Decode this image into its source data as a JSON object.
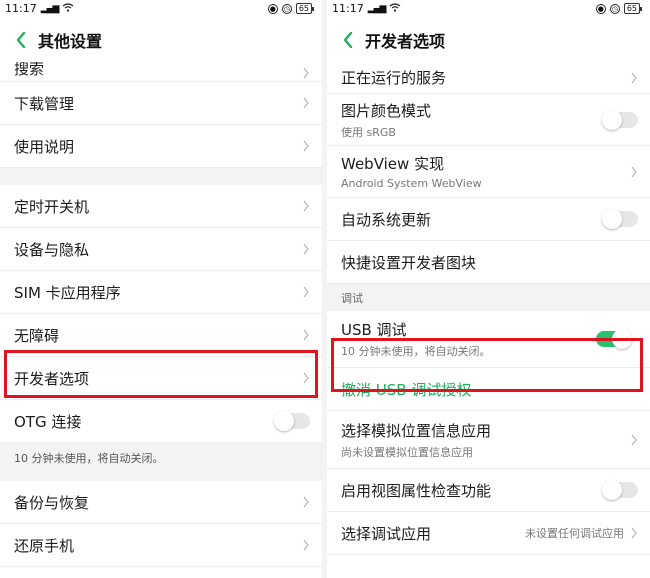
{
  "statusbar": {
    "time": "11:17",
    "signal": "4G",
    "battery": "65"
  },
  "left": {
    "title": "其他设置",
    "top_partial": "搜索",
    "group1": [
      {
        "label": "下载管理"
      },
      {
        "label": "使用说明"
      }
    ],
    "group2": [
      {
        "label": "定时开关机"
      },
      {
        "label": "设备与隐私"
      },
      {
        "label": "SIM 卡应用程序"
      },
      {
        "label": "无障碍"
      },
      {
        "label": "开发者选项"
      }
    ],
    "otg_label": "OTG 连接",
    "otg_toggle": "off",
    "otg_note": "10 分钟未使用，将自动关闭。",
    "group3": [
      {
        "label": "备份与恢复"
      },
      {
        "label": "还原手机"
      }
    ]
  },
  "right": {
    "title": "开发者选项",
    "running_services": "正在运行的服务",
    "picture_color_mode": "图片颜色模式",
    "picture_color_mode_sub": "使用 sRGB",
    "picture_color_mode_toggle": "off",
    "webview": "WebView 实现",
    "webview_sub": "Android System WebView",
    "auto_update": "自动系统更新",
    "auto_update_toggle": "off",
    "quick_tiles": "快捷设置开发者图块",
    "section_debug": "调试",
    "usb_debug": "USB 调试",
    "usb_debug_sub": "10 分钟未使用，将自动关闭。",
    "usb_debug_toggle": "on",
    "revoke_usb": "撤消 USB 调试授权",
    "mock_location": "选择模拟位置信息应用",
    "mock_location_sub": "尚未设置模拟位置信息应用",
    "view_attr": "启用视图属性检查功能",
    "view_attr_toggle": "off",
    "debug_app": "选择调试应用",
    "debug_app_value": "未设置任何调试应用"
  },
  "colors": {
    "accent_green": "#20ad5c",
    "highlight_red": "#e0141e",
    "toggle_on": "#2bbf6e"
  },
  "icons": [
    "back-arrow-icon",
    "chevron-right-icon",
    "wifi-icon",
    "alarm-icon",
    "battery-icon"
  ]
}
